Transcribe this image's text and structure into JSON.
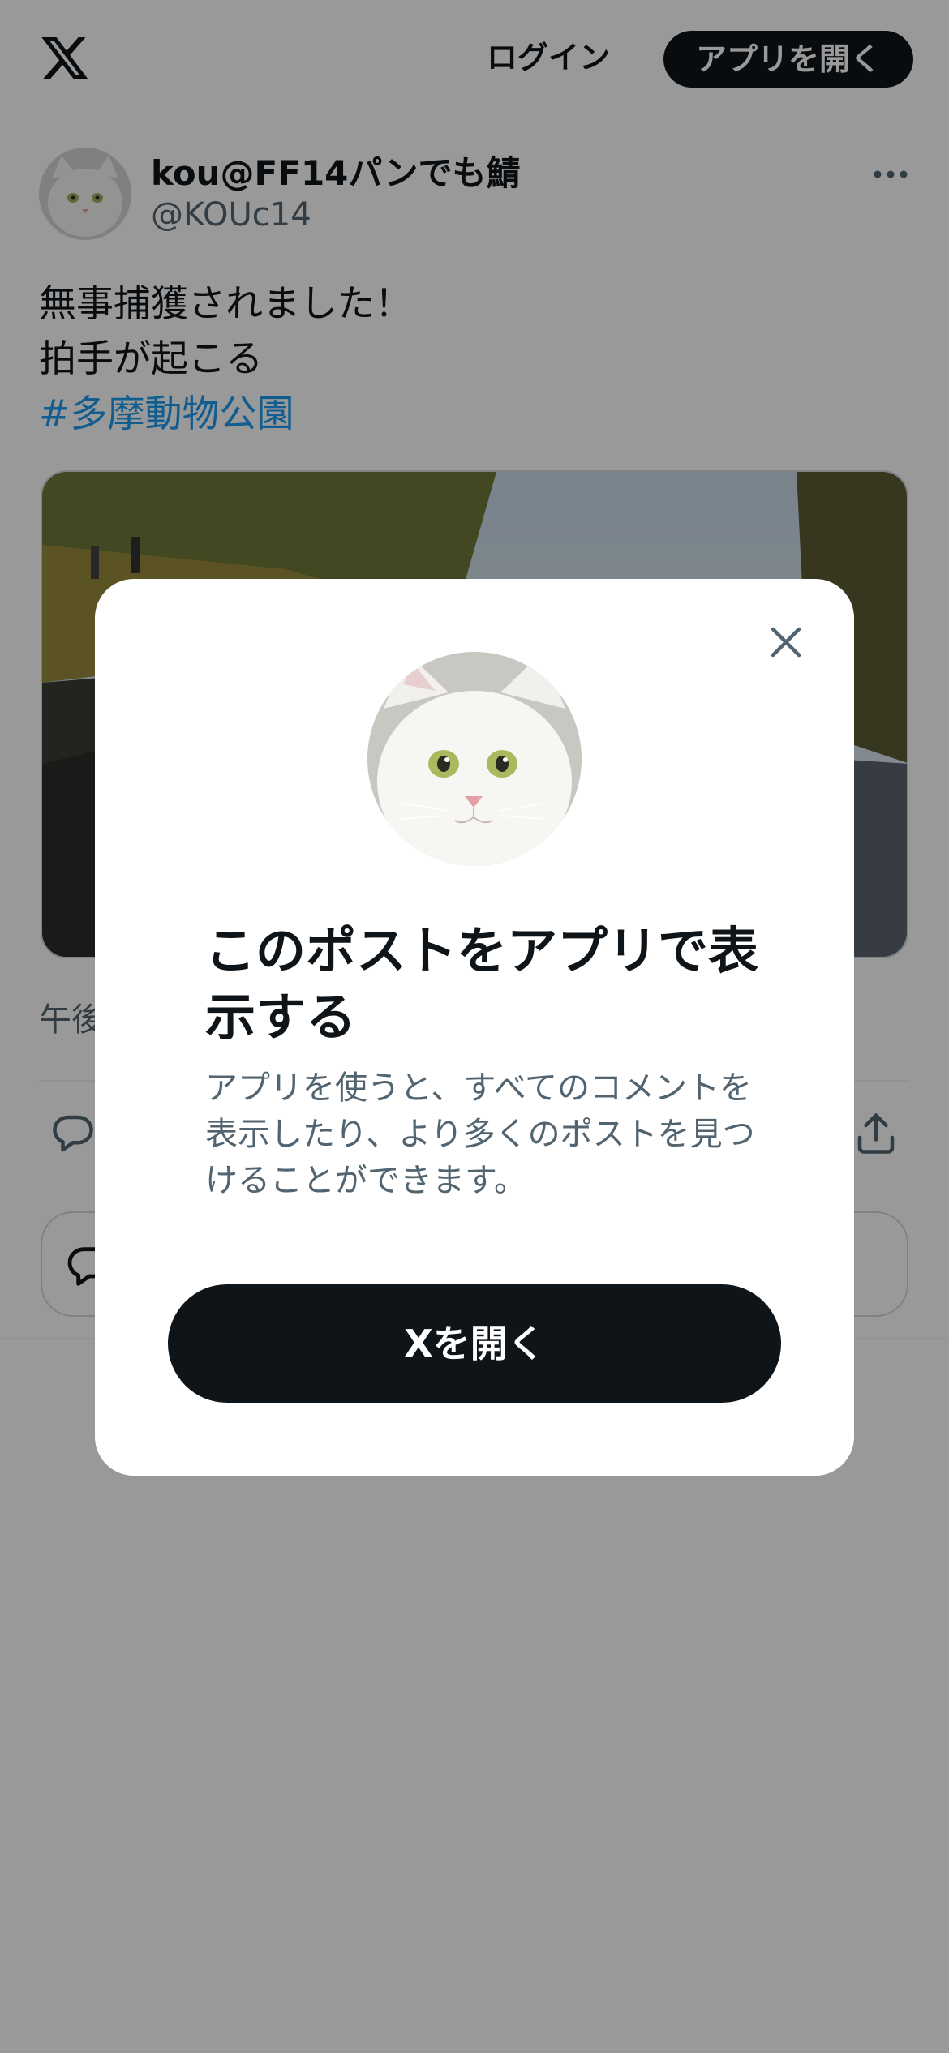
{
  "header": {
    "logo_icon": "x-logo-icon",
    "login_label": "ログイン",
    "open_app_label": "アプリを開く"
  },
  "post": {
    "author_name": "kou@FF14パンでも鯖",
    "author_handle": "@KOUc14",
    "more_icon": "more-horizontal-icon",
    "text_lines": [
      "無事捕獲されました！",
      "拍手が起こる"
    ],
    "hashtag": "#多摩動物公園",
    "timestamp_partial": "午後",
    "actions": {
      "reply_icon": "reply-icon",
      "share_icon": "share-icon"
    },
    "reply_box_icon": "reply-icon"
  },
  "modal": {
    "close_icon": "close-icon",
    "title": "このポストをアプリで表示する",
    "description": "アプリを使うと、すべてのコメントを表示したり、より多くのポストを見つけることができます。",
    "cta_label": "Xを開く"
  },
  "colors": {
    "text_primary": "#0f1419",
    "text_secondary": "#536471",
    "link": "#1d9bf0",
    "button_dark": "#0f1419",
    "overlay": "rgba(0,0,0,0.4)"
  }
}
